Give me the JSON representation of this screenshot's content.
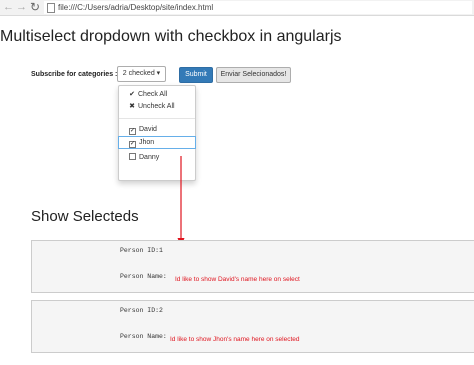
{
  "browser": {
    "back_icon": "←",
    "forward_icon": "→",
    "reload_icon": "↻",
    "url": "file:///C:/Users/adria/Desktop/site/index.html"
  },
  "page": {
    "title": "Multiselect dropdown with checkbox in angularjs"
  },
  "form": {
    "label": "Subscribe for categories :",
    "dropdown_label": "2 checked",
    "dropdown_caret": "▾",
    "submit_label": "Submit",
    "send_label": "Enviar Selecionados!"
  },
  "menu": {
    "check_all_icon": "✔",
    "check_all": "Check All",
    "uncheck_all_icon": "✖",
    "uncheck_all": "Uncheck All",
    "check_mark": "✓",
    "items": [
      {
        "label": "David",
        "checked": true
      },
      {
        "label": "Jhon",
        "checked": true
      },
      {
        "label": "Danny",
        "checked": false
      }
    ]
  },
  "selected": {
    "title": "Show Selecteds",
    "panels": [
      {
        "id_line": "Person ID:1",
        "name_label": "Person Name:",
        "note": "Id like to show David's name here on select"
      },
      {
        "id_line": "Person ID:2",
        "name_label": "Person Name:",
        "note": "Id like to show Jhon's name  here on selected"
      }
    ]
  },
  "colors": {
    "primary": "#337ab7",
    "annotation": "#e0141e",
    "focus": "#66afe9"
  }
}
